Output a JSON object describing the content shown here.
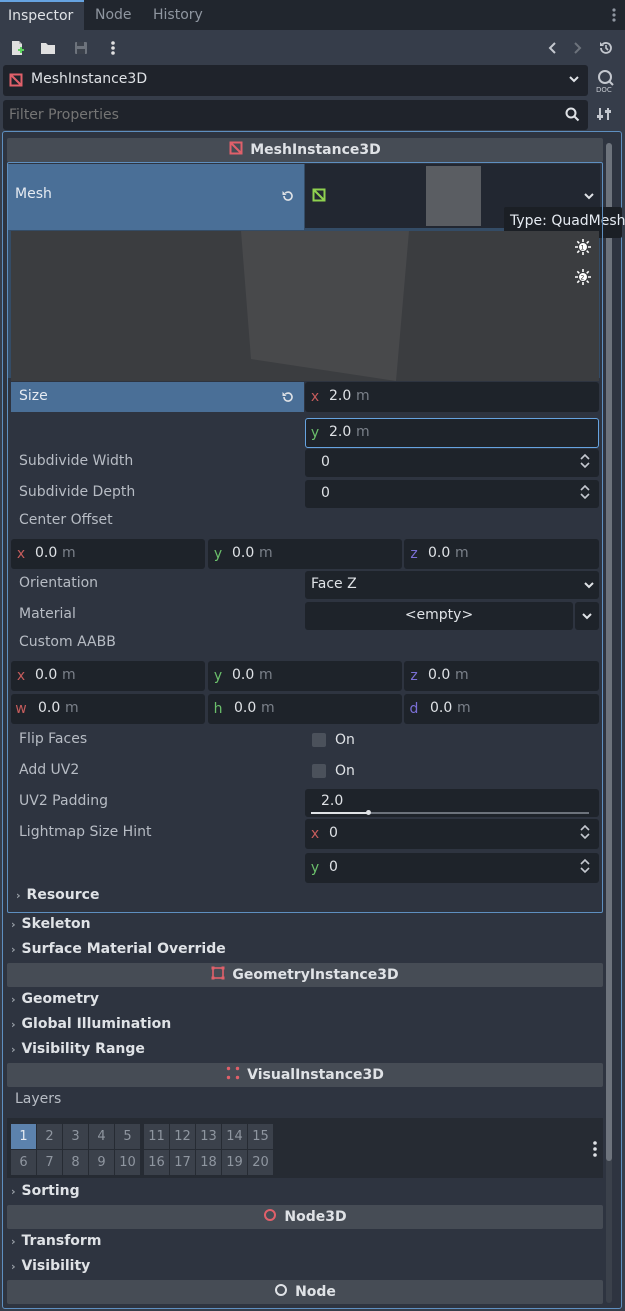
{
  "tabs": [
    "Inspector",
    "Node",
    "History"
  ],
  "node": {
    "type": "MeshInstance3D"
  },
  "filter": {
    "placeholder": "Filter Properties"
  },
  "tooltip": "Type: QuadMesh",
  "headers": {
    "mesh_instance": "MeshInstance3D",
    "geometry_instance": "GeometryInstance3D",
    "visual_instance": "VisualInstance3D",
    "node3d": "Node3D",
    "node": "Node"
  },
  "props": {
    "mesh": "Mesh",
    "size": "Size",
    "size_x": "2.0",
    "size_y": "2.0",
    "subdiv_w": "Subdivide Width",
    "subdiv_w_val": "0",
    "subdiv_d": "Subdivide Depth",
    "subdiv_d_val": "0",
    "center_offset": "Center Offset",
    "co_x": "0.0",
    "co_y": "0.0",
    "co_z": "0.0",
    "orientation": "Orientation",
    "orientation_val": "Face Z",
    "material": "Material",
    "material_val": "<empty>",
    "custom_aabb": "Custom AABB",
    "aabb_x": "0.0",
    "aabb_y": "0.0",
    "aabb_z": "0.0",
    "aabb_w": "0.0",
    "aabb_h": "0.0",
    "aabb_d": "0.0",
    "flip_faces": "Flip Faces",
    "add_uv2": "Add UV2",
    "on_label": "On",
    "uv2_padding": "UV2 Padding",
    "uv2_padding_val": "2.0",
    "lightmap": "Lightmap Size Hint",
    "lm_x": "0",
    "lm_y": "0",
    "unit": "m",
    "ax_x": "x",
    "ax_y": "y",
    "ax_z": "z",
    "ax_w": "w",
    "ax_h": "h",
    "ax_d": "d"
  },
  "sections": {
    "resource": "Resource",
    "skeleton": "Skeleton",
    "surface_override": "Surface Material Override",
    "geometry": "Geometry",
    "global_illumination": "Global Illumination",
    "visibility_range": "Visibility Range",
    "sorting": "Sorting",
    "transform": "Transform",
    "visibility": "Visibility"
  },
  "layers": {
    "label": "Layers",
    "row1": [
      "1",
      "2",
      "3",
      "4",
      "5",
      "11",
      "12",
      "13",
      "14",
      "15"
    ],
    "row2": [
      "6",
      "7",
      "8",
      "9",
      "10",
      "16",
      "17",
      "18",
      "19",
      "20"
    ],
    "active": "1"
  },
  "colors": {
    "accent": "#66a3e0",
    "mesh_icon": "#e0606a",
    "axis_x": "#c55c5c",
    "axis_y": "#6bbf6b",
    "axis_z": "#7b6fd6"
  }
}
